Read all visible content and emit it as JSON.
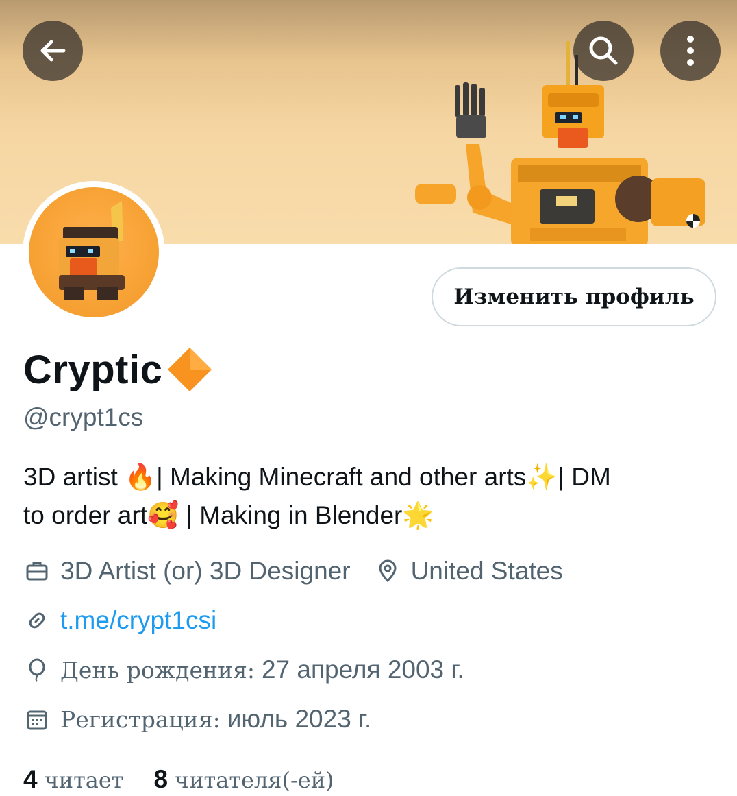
{
  "header": {
    "back_icon": "arrow-left-icon",
    "search_icon": "search-icon",
    "more_icon": "more-vertical-icon"
  },
  "profile": {
    "edit_button_label": "Изменить профиль",
    "display_name": "Cryptic",
    "badge_emoji": "🔶",
    "handle": "@crypt1cs",
    "bio_line1": "3D artist 🔥| Making Minecraft and other arts✨| DM",
    "bio_line2": "to order art🥰  | Making in Blender🌟"
  },
  "meta": {
    "profession": "3D Artist (or) 3D Designer",
    "location": "United States",
    "link": "t.me/crypt1csi",
    "birthday_label": "День рождения:",
    "birthday_value": "27 апреля 2003 г.",
    "joined_label": "Регистрация:",
    "joined_value": "июль 2023 г."
  },
  "stats": {
    "following_count": "4",
    "following_label": "читает",
    "followers_count": "8",
    "followers_label": "читателя(-ей)"
  },
  "colors": {
    "text": "#0f1419",
    "secondary": "#536471",
    "link": "#1d9bf0",
    "border": "#cfd9de",
    "banner": "#f6d7a4",
    "accent_orange": "#f7a235"
  }
}
